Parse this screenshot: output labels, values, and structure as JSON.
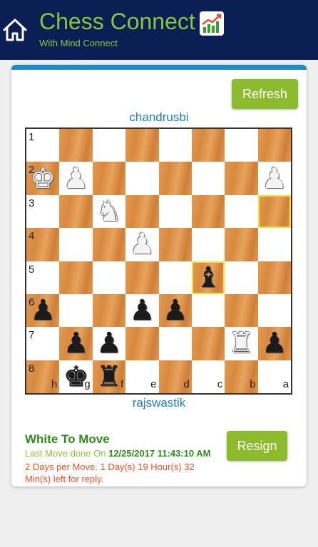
{
  "header": {
    "title": "Chess Connect",
    "subtitle": "With Mind Connect",
    "home_icon": "home-icon",
    "logo_icon": "chart-logo-icon",
    "background": "#0b1f55",
    "accent": "#8ac43f"
  },
  "game": {
    "refresh_label": "Refresh",
    "resign_label": "Resign",
    "top_player": "chandrusbi",
    "bottom_player": "rajswastik",
    "status": "White To Move",
    "last_move_prefix": "Last Move done On",
    "last_move_time": "12/25/2017 11:43:10 AM",
    "time_left": "2 Days per Move. 1 Day(s) 19 Hour(s) 32 Min(s) left for reply."
  },
  "board": {
    "rank_labels": [
      "1",
      "2",
      "3",
      "4",
      "5",
      "6",
      "7",
      "8"
    ],
    "file_labels": [
      "h",
      "g",
      "f",
      "e",
      "d",
      "c",
      "b",
      "a"
    ],
    "pieces": [
      {
        "row": 1,
        "col": 0,
        "color": "w",
        "type": "king",
        "glyph": "♚"
      },
      {
        "row": 1,
        "col": 1,
        "color": "w",
        "type": "pawn",
        "glyph": "♟"
      },
      {
        "row": 1,
        "col": 7,
        "color": "w",
        "type": "pawn",
        "glyph": "♟"
      },
      {
        "row": 2,
        "col": 2,
        "color": "w",
        "type": "knight",
        "glyph": "♞"
      },
      {
        "row": 3,
        "col": 3,
        "color": "w",
        "type": "pawn",
        "glyph": "♟"
      },
      {
        "row": 4,
        "col": 5,
        "color": "b",
        "type": "bishop",
        "glyph": "♝"
      },
      {
        "row": 5,
        "col": 0,
        "color": "b",
        "type": "pawn",
        "glyph": "♟"
      },
      {
        "row": 5,
        "col": 3,
        "color": "b",
        "type": "pawn",
        "glyph": "♟"
      },
      {
        "row": 5,
        "col": 4,
        "color": "b",
        "type": "pawn",
        "glyph": "♟"
      },
      {
        "row": 6,
        "col": 1,
        "color": "b",
        "type": "pawn",
        "glyph": "♟"
      },
      {
        "row": 6,
        "col": 2,
        "color": "b",
        "type": "pawn",
        "glyph": "♟"
      },
      {
        "row": 6,
        "col": 6,
        "color": "w",
        "type": "rook",
        "glyph": "♜"
      },
      {
        "row": 6,
        "col": 7,
        "color": "b",
        "type": "pawn",
        "glyph": "♟"
      },
      {
        "row": 7,
        "col": 1,
        "color": "b",
        "type": "king",
        "glyph": "♚"
      },
      {
        "row": 7,
        "col": 2,
        "color": "b",
        "type": "rook",
        "glyph": "♜"
      }
    ],
    "highlighted": [
      {
        "row": 2,
        "col": 7
      },
      {
        "row": 4,
        "col": 5
      }
    ]
  }
}
